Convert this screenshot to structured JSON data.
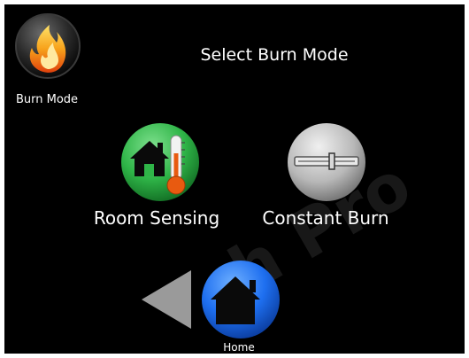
{
  "header": {
    "title": "Select Burn Mode",
    "mode_button_label": "Burn Mode"
  },
  "options": {
    "room_sensing": {
      "label": "Room Sensing",
      "icon": "house-thermometer-icon"
    },
    "constant_burn": {
      "label": "Constant Burn",
      "icon": "slider-icon"
    }
  },
  "nav": {
    "back_icon": "back-arrow-icon",
    "home_label": "Home",
    "home_icon": "home-icon"
  },
  "colors": {
    "background": "#000000",
    "room_sensing": "#2fb548",
    "constant_burn": "#b8b8b8",
    "home": "#1e6ff0",
    "back_arrow": "#9a9a9a",
    "flame": "#f7a21b"
  }
}
